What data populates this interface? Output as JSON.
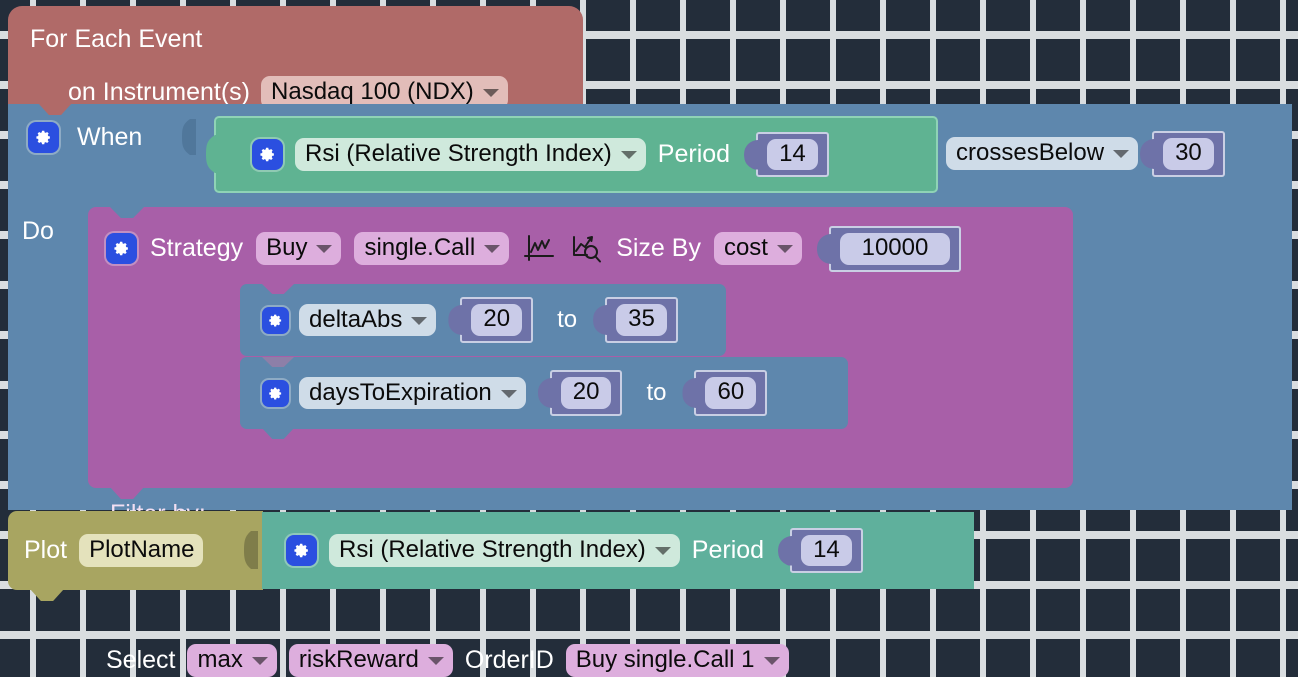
{
  "canvas": {
    "background_color": "#232d3a",
    "grid_dot_color": "#d9dde0",
    "grid_spacing_px": 50
  },
  "blocks": {
    "for_each_event": {
      "title": "For Each Event",
      "instrument_label": "on Instrument(s)",
      "instrument_value": "Nasdaq 100 (NDX)",
      "color": "#b06a68"
    },
    "when": {
      "label": "When",
      "color": "#5e87ad",
      "indicator": {
        "name": "Rsi (Relative Strength Index)",
        "period_label": "Period",
        "period_value": "14",
        "color": "#5fb392"
      },
      "comparator": "crossesBelow",
      "threshold": "30"
    },
    "do": {
      "label": "Do",
      "color": "#5e87ad"
    },
    "strategy": {
      "label": "Strategy",
      "color": "#a85fa8",
      "action": "Buy",
      "instrument_type": "single.Call",
      "icons": [
        "chart-axes-icon",
        "chart-search-icon"
      ],
      "size_by_label": "Size By",
      "size_by_mode": "cost",
      "size_by_value": "10000",
      "filter_label": "Filter by:",
      "filters": [
        {
          "field": "deltaAbs",
          "from": "20",
          "to_label": "to",
          "to": "35"
        },
        {
          "field": "daysToExpiration",
          "from": "20",
          "to_label": "to",
          "to": "60"
        }
      ],
      "select_label": "Select",
      "select_mode": "max",
      "select_metric": "riskReward",
      "orderid_label": "OrderID",
      "orderid_value": "Buy single.Call 1"
    },
    "plot": {
      "label": "Plot",
      "name_value": "PlotName",
      "color": "#a8a561",
      "indicator": {
        "name": "Rsi (Relative Strength Index)",
        "period_label": "Period",
        "period_value": "14",
        "color": "#5fb09c"
      }
    }
  }
}
